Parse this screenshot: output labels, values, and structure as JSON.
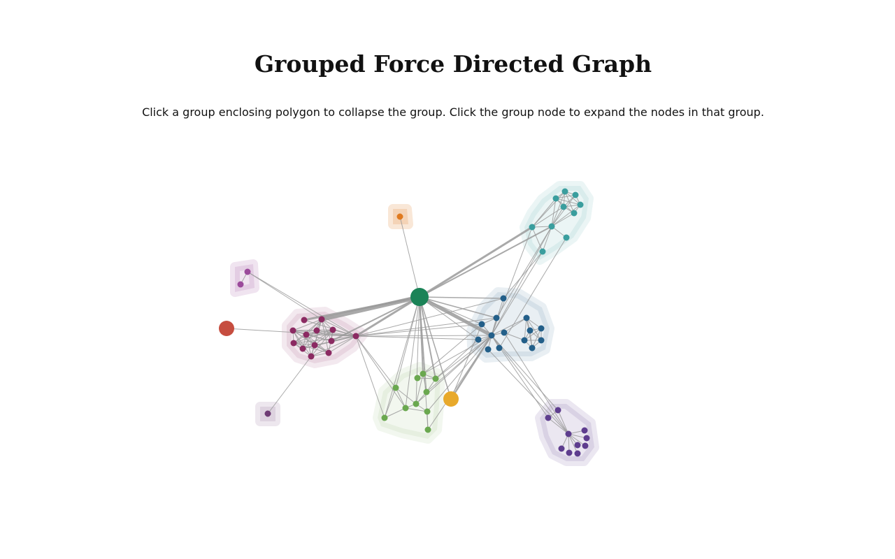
{
  "page": {
    "title": "Grouped Force Directed Graph",
    "instructions": "Click a group enclosing polygon to collapse the group. Click the group node to expand the nodes in that group."
  },
  "groups": [
    {
      "id": "teal",
      "color": "#3a9e9e",
      "state": "expanded"
    },
    {
      "id": "blue",
      "color": "#235f89",
      "state": "expanded"
    },
    {
      "id": "magenta",
      "color": "#8b2a62",
      "state": "expanded"
    },
    {
      "id": "green",
      "color": "#6aa84f",
      "state": "expanded"
    },
    {
      "id": "purple",
      "color": "#5e3d8e",
      "state": "expanded"
    },
    {
      "id": "orange",
      "color": "#e07a1f",
      "state": "expanded"
    },
    {
      "id": "violet",
      "color": "#9b4a9b",
      "state": "expanded"
    },
    {
      "id": "plum",
      "color": "#6e3b74",
      "state": "expanded"
    },
    {
      "id": "dkgreen",
      "color": "#1b8357",
      "state": "collapsed"
    },
    {
      "id": "red",
      "color": "#c64d3f",
      "state": "collapsed"
    },
    {
      "id": "gold",
      "color": "#e8a92b",
      "state": "collapsed"
    }
  ],
  "legend": []
}
